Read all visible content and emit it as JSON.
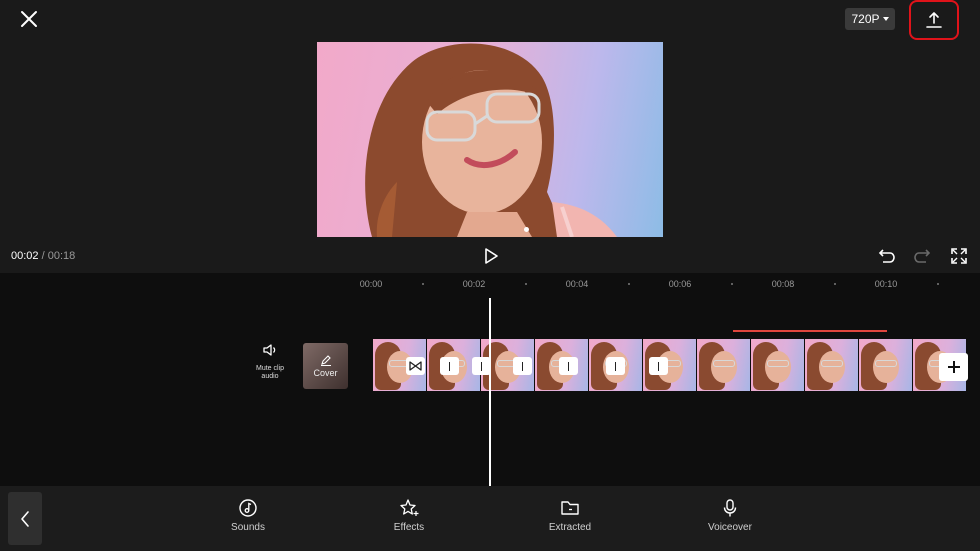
{
  "header": {
    "resolution_label": "720P",
    "close_icon": "close-icon",
    "export_icon": "export-upload-icon",
    "export_highlight_color": "#e0131a"
  },
  "player": {
    "current_time": "00:02",
    "separator": " / ",
    "total_time": "00:18",
    "play_icon": "play-icon",
    "undo_icon": "undo-icon",
    "redo_icon": "redo-icon",
    "fullscreen_icon": "fullscreen-icon"
  },
  "timeline": {
    "ruler": [
      "00:00",
      "00:02",
      "00:04",
      "00:06",
      "00:08",
      "00:10"
    ],
    "mute_label": "Mute clip audio",
    "cover_label": "Cover",
    "frame_count": 11,
    "audio_marker_color": "#e0463e"
  },
  "toolbar": {
    "back_icon": "chevron-left-icon",
    "items": [
      {
        "label": "Sounds",
        "icon": "music-note-icon"
      },
      {
        "label": "Effects",
        "icon": "star-sparkle-icon"
      },
      {
        "label": "Extracted",
        "icon": "folder-icon"
      },
      {
        "label": "Voiceover",
        "icon": "microphone-icon"
      }
    ]
  }
}
